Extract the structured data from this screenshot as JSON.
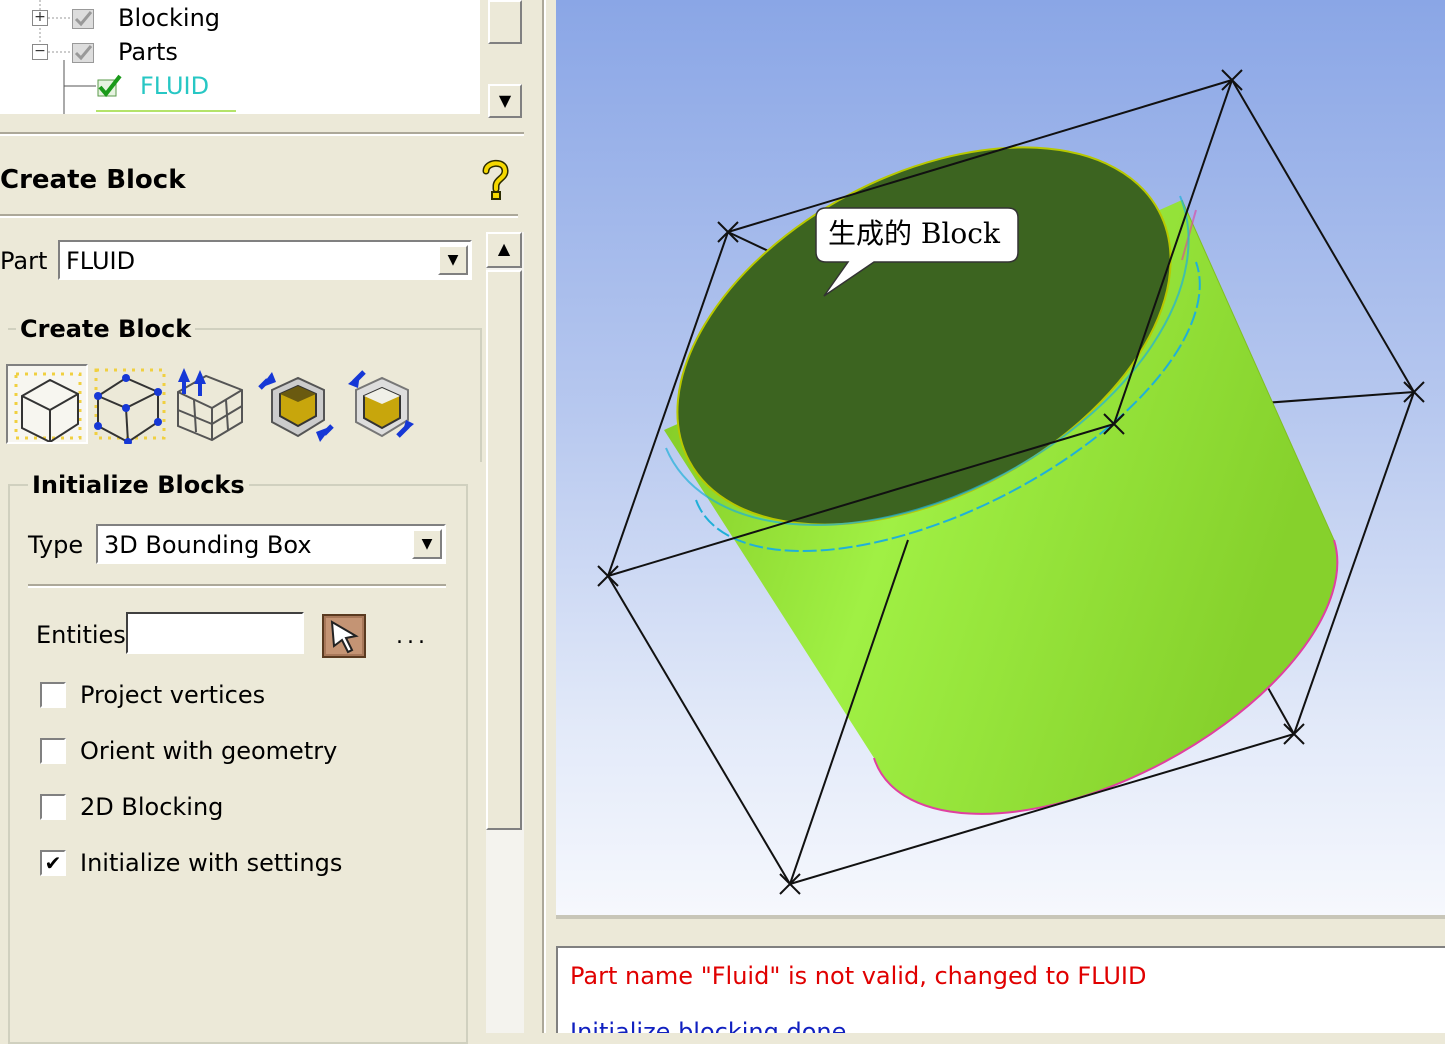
{
  "tree": {
    "items": [
      {
        "label": "Blocking",
        "expander": "+",
        "color": "#000000"
      },
      {
        "label": "Parts",
        "expander": "−",
        "color": "#000000"
      },
      {
        "label": "FLUID",
        "color": "#27c7c4"
      }
    ]
  },
  "panel": {
    "title": "Create Block",
    "help_icon": "help-question-icon",
    "part_label": "Part",
    "part_value": "FLUID",
    "create_block_group": "Create Block",
    "tools": [
      {
        "name": "initialize-blocks-icon",
        "active": true
      },
      {
        "name": "from-vertices-faces-icon",
        "active": false
      },
      {
        "name": "extrude-2d-blocks-icon",
        "active": false
      },
      {
        "name": "2d-to-3d-icon",
        "active": false
      },
      {
        "name": "3d-to-2d-icon",
        "active": false
      }
    ],
    "init_group": "Initialize Blocks",
    "type_label": "Type",
    "type_value": "3D Bounding Box",
    "entities_label": "Entities",
    "entities_value": "",
    "more_label": "...",
    "options": [
      {
        "label": "Project vertices",
        "checked": false
      },
      {
        "label": "Orient with geometry",
        "checked": false
      },
      {
        "label": "2D Blocking",
        "checked": false
      },
      {
        "label": "Initialize with settings",
        "checked": true
      }
    ]
  },
  "viewport": {
    "callout": "生成的 Block"
  },
  "messages": [
    {
      "text": "Part name \"Fluid\" is not valid, changed to FLUID",
      "color": "#e00000"
    },
    {
      "text": "Initialize blocking done",
      "color": "#1020c0"
    }
  ]
}
